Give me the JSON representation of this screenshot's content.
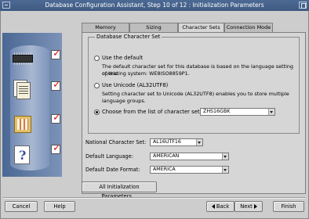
{
  "window": {
    "title": "Database Configuration Assistant, Step 10 of 12 : Initialization Parameters"
  },
  "tabs": [
    {
      "label": "Memory",
      "active": false
    },
    {
      "label": "Sizing",
      "active": false
    },
    {
      "label": "Character Sets",
      "active": true
    },
    {
      "label": "Connection Mode",
      "active": false
    }
  ],
  "charset_group": {
    "legend": "Database Character Set",
    "use_default": {
      "label": "Use the default",
      "desc_line1": "The default character set for this database is based on the language setting of this",
      "desc_line2": "operating system: WE8ISO8859P1.",
      "selected": false
    },
    "use_unicode": {
      "label": "Use Unicode (AL32UTF8)",
      "desc_line1": "Setting character set to Unicode (AL32UTF8) enables you to store multiple",
      "desc_line2": "language groups.",
      "selected": false
    },
    "choose_list": {
      "label": "Choose from the list of character sets",
      "value": "ZHS16GBK",
      "selected": true
    }
  },
  "fields": {
    "national_charset": {
      "label": "National Character Set:",
      "value": "AL16UTF16"
    },
    "default_language": {
      "label": "Default Language:",
      "value": "AMERICAN"
    },
    "default_date_format": {
      "label": "Default Date Format:",
      "value": "AMERICA"
    }
  },
  "buttons": {
    "all_params": "All Initialization Parameters...",
    "cancel": "Cancel",
    "help": "Help",
    "back": "Back",
    "next": "Next",
    "finish": "Finish"
  },
  "illustration": {
    "items": [
      "chip-icon",
      "documents-icon",
      "calculator-icon",
      "help-book-icon"
    ],
    "checks": [
      true,
      true,
      true,
      true
    ],
    "check_color": "#d21a1a",
    "panel_color": "#4f6e9a"
  },
  "colors": {
    "titlebar": "#4d6a95",
    "window_bg": "#cdcdcd"
  }
}
